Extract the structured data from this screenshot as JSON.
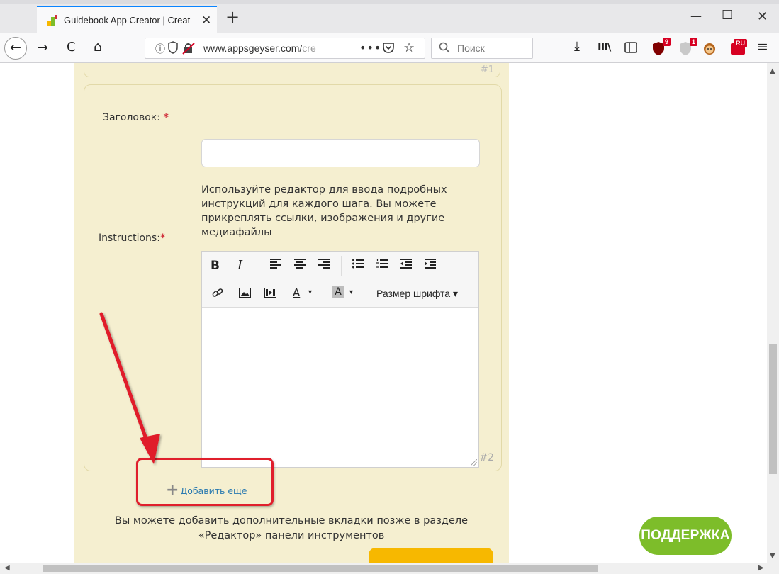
{
  "browser": {
    "tab_title": "Guidebook App Creator | Creat",
    "url_host": "www.appsgeyser.com/",
    "url_rest": "cre",
    "search_placeholder": "Поиск",
    "badges": {
      "ext1": "9",
      "ext2": "1",
      "ext3": "RU"
    }
  },
  "form": {
    "prev_step_number": "#1",
    "title_label": "Заголовок:",
    "required_mark": "*",
    "title_value": "",
    "help_text": "Используйте редактор для ввода подробных инструкций для каждого шага. Вы можете прикреплять ссылки, изображения и другие медиафайлы",
    "instructions_label": "Instructions:",
    "editor_font_size": "Размер шрифта",
    "step_number": "#2",
    "add_more": "Добавить еще",
    "note_line1": "Вы можете добавить дополнительные вкладки позже в разделе",
    "note_line2": "«Редактор» панели инструментов"
  },
  "support_button": "ПОДДЕРЖКА",
  "colors": {
    "content_bg": "#f5efd0",
    "highlight": "#e01f2c",
    "support": "#7dbd2a",
    "next_button": "#f7b800",
    "link": "#2a7ab0"
  }
}
